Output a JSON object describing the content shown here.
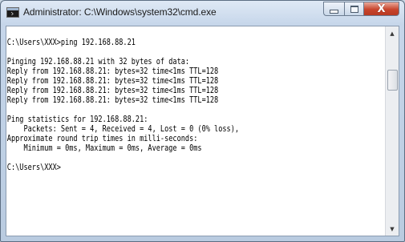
{
  "window": {
    "title": "Administrator: C:\\Windows\\system32\\cmd.exe",
    "icon": "cmd-icon",
    "buttons": {
      "minimize": "minimize-icon",
      "maximize": "maximize-icon",
      "close": "X"
    }
  },
  "console": {
    "lines": [
      "",
      "C:\\Users\\XXX>ping 192.168.88.21",
      "",
      "Pinging 192.168.88.21 with 32 bytes of data:",
      "Reply from 192.168.88.21: bytes=32 time<1ms TTL=128",
      "Reply from 192.168.88.21: bytes=32 time<1ms TTL=128",
      "Reply from 192.168.88.21: bytes=32 time<1ms TTL=128",
      "Reply from 192.168.88.21: bytes=32 time<1ms TTL=128",
      "",
      "Ping statistics for 192.168.88.21:",
      "    Packets: Sent = 4, Received = 4, Lost = 0 (0% loss),",
      "Approximate round trip times in milli-seconds:",
      "    Minimum = 0ms, Maximum = 0ms, Average = 0ms",
      "",
      "C:\\Users\\XXX>"
    ]
  },
  "scrollbar": {
    "up_icon": "▲",
    "down_icon": "▼"
  }
}
